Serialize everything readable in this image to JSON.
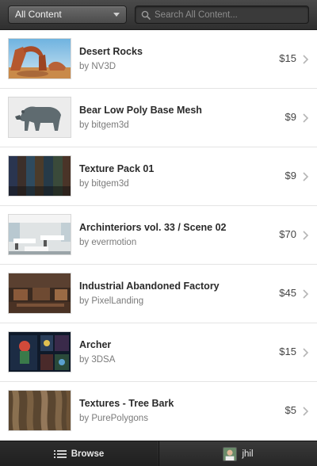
{
  "header": {
    "filter_selected": "All Content",
    "search_placeholder": "Search All Content..."
  },
  "items": [
    {
      "title": "Desert Rocks",
      "author": "by NV3D",
      "price": "$15",
      "thumb": "desert-rocks-image"
    },
    {
      "title": "Bear Low Poly Base Mesh",
      "author": "by bitgem3d",
      "price": "$9",
      "thumb": "bear-mesh-image"
    },
    {
      "title": "Texture Pack 01",
      "author": "by bitgem3d",
      "price": "$9",
      "thumb": "texture-pack-image"
    },
    {
      "title": "Archinteriors vol. 33 / Scene 02",
      "author": "by evermotion",
      "price": "$70",
      "thumb": "office-interior-image"
    },
    {
      "title": "Industrial Abandoned Factory",
      "author": "by PixelLanding",
      "price": "$45",
      "thumb": "factory-image"
    },
    {
      "title": "Archer",
      "author": "by 3DSA",
      "price": "$15",
      "thumb": "archer-character-image"
    },
    {
      "title": "Textures - Tree Bark",
      "author": "by PurePolygons",
      "price": "$5",
      "thumb": "tree-bark-image"
    }
  ],
  "tabbar": {
    "browse_label": "Browse",
    "user_label": "jhil"
  },
  "colors": {
    "header_bg": "#3a3a3a",
    "tabbar_bg": "#2a2a2a",
    "divider": "#e4e4e4"
  }
}
